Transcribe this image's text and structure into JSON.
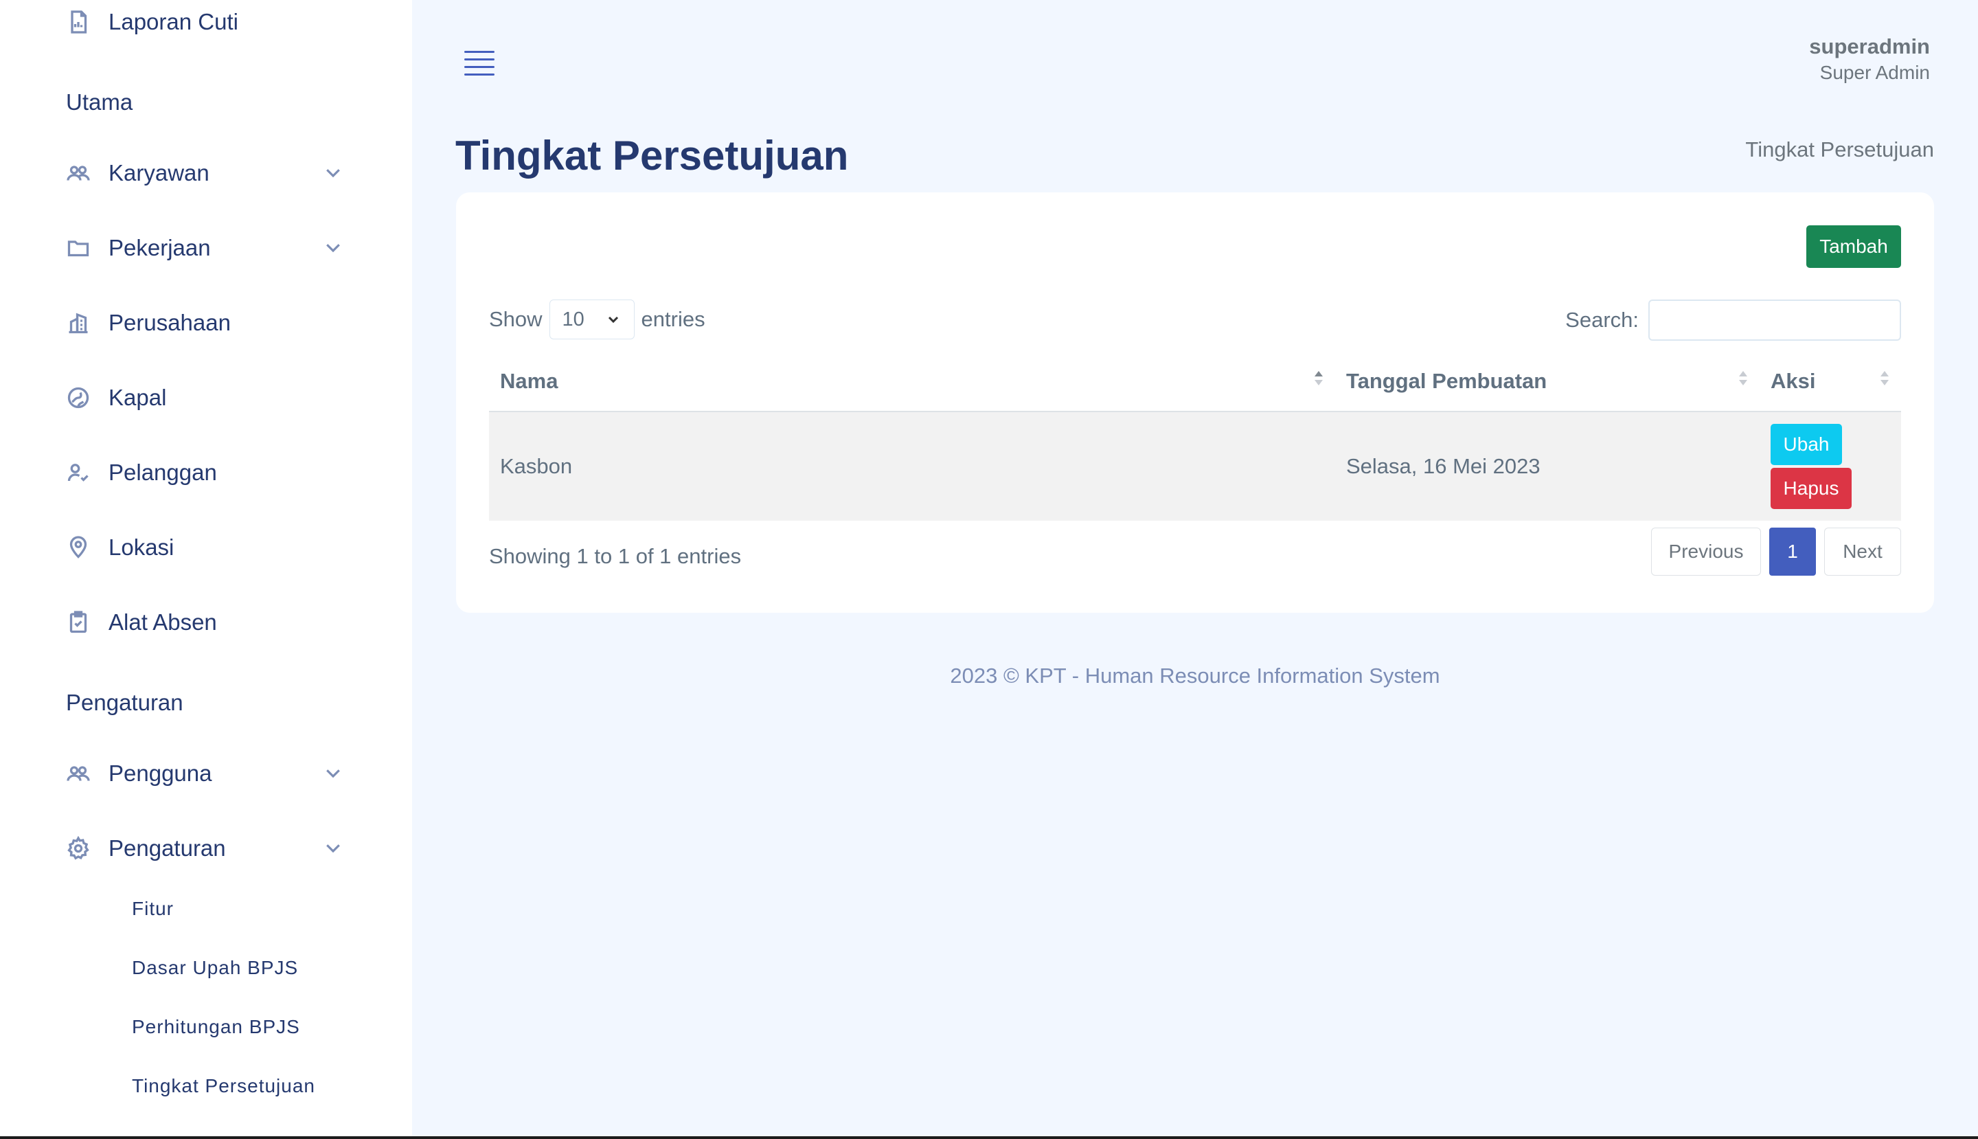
{
  "sidebar": {
    "top_item": "Laporan Cuti",
    "section_main": "Utama",
    "items": [
      {
        "label": "Karyawan",
        "icon": "people-icon"
      },
      {
        "label": "Pekerjaan",
        "icon": "folder-icon"
      },
      {
        "label": "Perusahaan",
        "icon": "building-icon"
      },
      {
        "label": "Kapal",
        "icon": "globe-icon"
      },
      {
        "label": "Pelanggan",
        "icon": "person-check-icon"
      },
      {
        "label": "Lokasi",
        "icon": "location-pin-icon"
      },
      {
        "label": "Alat Absen",
        "icon": "clipboard-check-icon"
      }
    ],
    "section_settings": "Pengaturan",
    "settings_items": [
      {
        "label": "Pengguna",
        "icon": "people-icon"
      },
      {
        "label": "Pengaturan",
        "icon": "gear-icon"
      }
    ],
    "sub_items": [
      "Fitur",
      "Dasar Upah BPJS",
      "Perhitungan BPJS",
      "Tingkat Persetujuan"
    ]
  },
  "header": {
    "user_name": "superadmin",
    "user_role": "Super Admin"
  },
  "page": {
    "title": "Tingkat Persetujuan",
    "breadcrumb": "Tingkat Persetujuan"
  },
  "card": {
    "add_button": "Tambah",
    "show_label": "Show",
    "entries_value": "10",
    "entries_label": "entries",
    "search_label": "Search:",
    "search_placeholder": "",
    "columns": [
      "Nama",
      "Tanggal Pembuatan",
      "Aksi"
    ],
    "rows": [
      {
        "nama": "Kasbon",
        "tanggal": "Selasa, 16 Mei 2023",
        "edit": "Ubah",
        "delete": "Hapus"
      }
    ],
    "info": "Showing 1 to 1 of 1 entries",
    "pagination": {
      "previous": "Previous",
      "page": "1",
      "next": "Next"
    }
  },
  "footer": "2023 © KPT - Human Resource Information System",
  "colors": {
    "primary": "#435ebe",
    "success": "#198754",
    "info": "#0dcaf0",
    "danger": "#dc3545",
    "background": "#f2f7ff"
  }
}
